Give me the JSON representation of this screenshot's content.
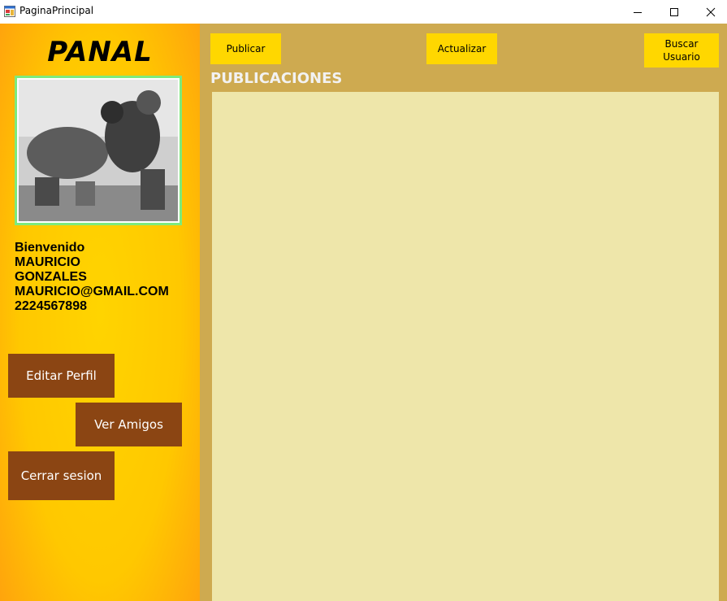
{
  "window": {
    "title": "PaginaPrincipal",
    "icon": "app-form-icon",
    "controls": [
      "minimize-icon",
      "maximize-icon",
      "close-icon"
    ]
  },
  "sidebar": {
    "brand": "PANAL",
    "profile_photo": "profile-photo",
    "user": {
      "greeting": "Bienvenido",
      "first_name": "MAURICIO",
      "last_name": "GONZALES",
      "email": "MAURICIO@GMAIL.COM",
      "phone": "2224567898"
    },
    "buttons": {
      "edit_profile": "Editar Perfil",
      "view_friends": "Ver Amigos",
      "logout": "Cerrar sesion"
    }
  },
  "toolbar": {
    "publish": "Publicar",
    "refresh": "Actualizar",
    "search_user_line1": "Buscar",
    "search_user_line2": "Usuario"
  },
  "main": {
    "section_title": "PUBLICACIONES"
  },
  "colors": {
    "sidebar_accent": "#ffc800",
    "side_button": "#8b4513",
    "main_background": "#ceaa50",
    "feed_background": "#eee6aa",
    "top_button": "#ffd700",
    "photo_border": "#7dea7d"
  }
}
